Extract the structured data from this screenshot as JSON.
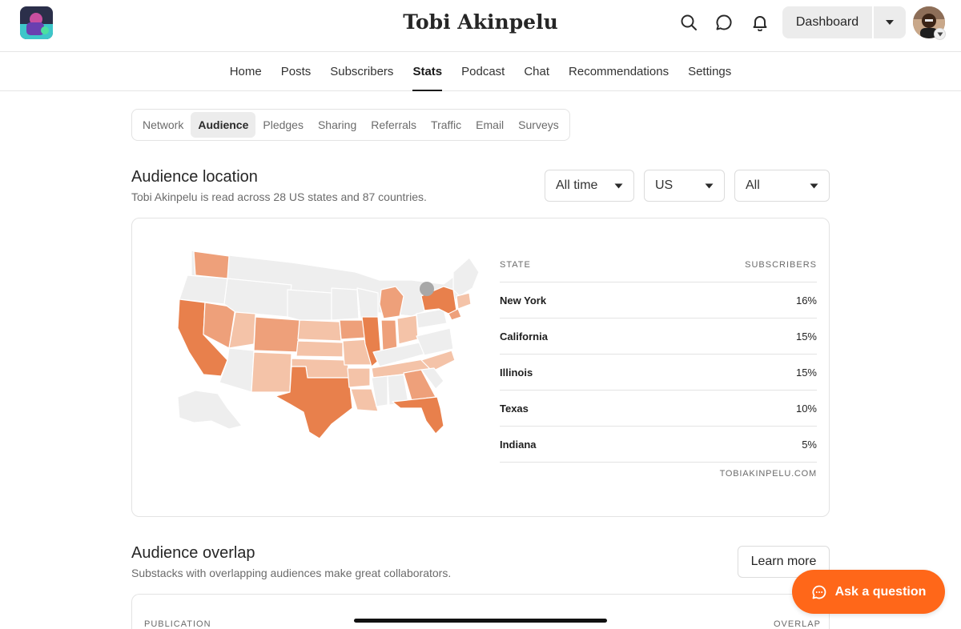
{
  "header": {
    "site_title": "Tobi Akinpelu",
    "dashboard_label": "Dashboard",
    "icons": [
      "search-icon",
      "chat-icon",
      "bell-icon",
      "caret-down-icon"
    ]
  },
  "nav": {
    "items": [
      "Home",
      "Posts",
      "Subscribers",
      "Stats",
      "Podcast",
      "Chat",
      "Recommendations",
      "Settings"
    ],
    "active": "Stats"
  },
  "subtabs": {
    "items": [
      "Network",
      "Audience",
      "Pledges",
      "Sharing",
      "Referrals",
      "Traffic",
      "Email",
      "Surveys"
    ],
    "active": "Audience"
  },
  "audience_location": {
    "title": "Audience location",
    "subtitle": "Tobi Akinpelu is read across 28 US states and 87 countries.",
    "filters": {
      "time": "All time",
      "region": "US",
      "segment": "All"
    },
    "table": {
      "col_state": "STATE",
      "col_subscribers": "SUBSCRIBERS",
      "rows": [
        {
          "state": "New York",
          "value": "16%"
        },
        {
          "state": "California",
          "value": "15%"
        },
        {
          "state": "Illinois",
          "value": "15%"
        },
        {
          "state": "Texas",
          "value": "10%"
        },
        {
          "state": "Indiana",
          "value": "5%"
        }
      ],
      "footer": "TOBIAKINPELU.COM"
    },
    "map_colors": {
      "high": "#e8804c",
      "mid": "#eea07a",
      "low": "#f4c3a8",
      "none": "#eeeeee",
      "marker": "#a8a8a8"
    }
  },
  "audience_overlap": {
    "title": "Audience overlap",
    "subtitle": "Substacks with overlapping audiences make great collaborators.",
    "learn_more": "Learn more",
    "col_publication": "PUBLICATION",
    "col_overlap": "OVERLAP"
  },
  "ask_button": {
    "label": "Ask a question",
    "color": "#ff6719"
  }
}
